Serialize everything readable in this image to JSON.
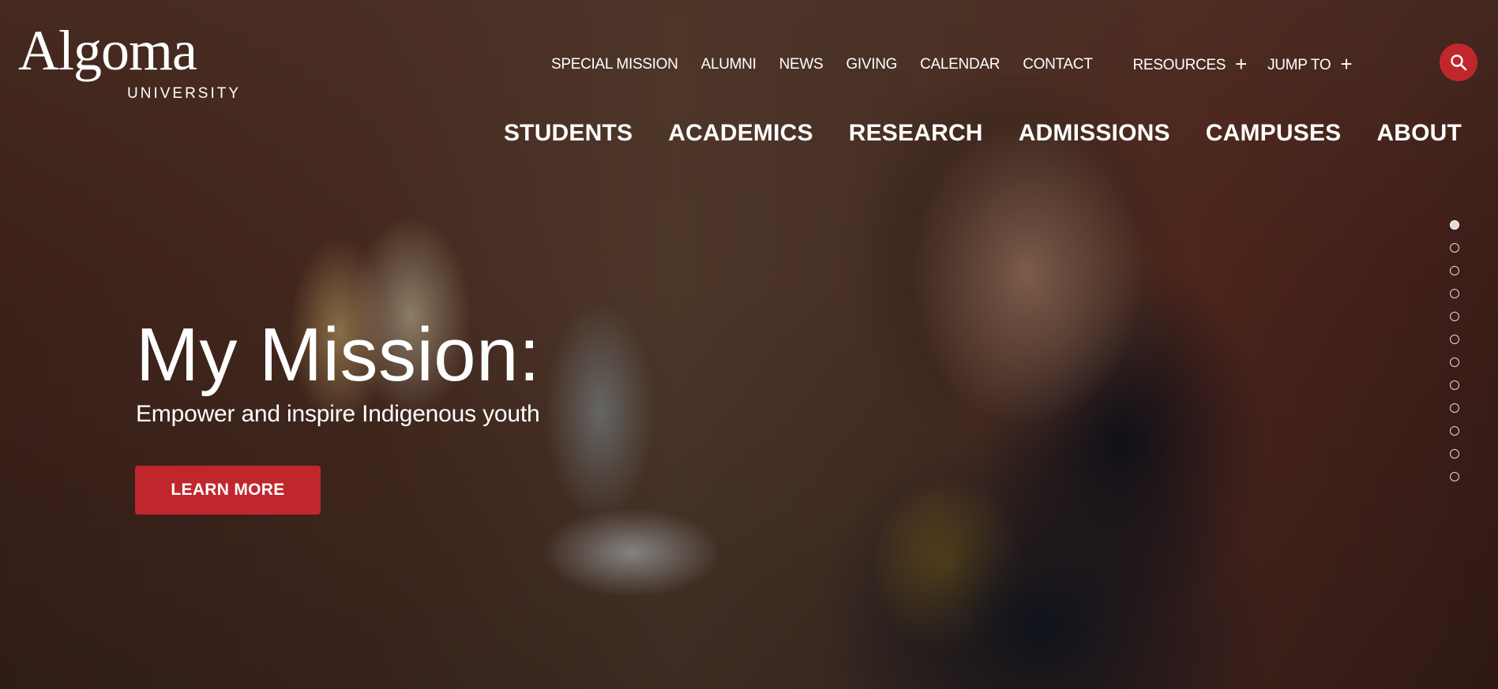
{
  "brand": {
    "logo_word": "Algoma",
    "logo_sub": "UNIVERSITY",
    "accent": "#c0272d"
  },
  "utility_nav": {
    "items": [
      "SPECIAL MISSION",
      "ALUMNI",
      "NEWS",
      "GIVING",
      "CALENDAR",
      "CONTACT"
    ],
    "resources": "RESOURCES",
    "jump_to": "JUMP TO",
    "plus": "+",
    "search_icon": "search-icon"
  },
  "main_nav": {
    "items": [
      "STUDENTS",
      "ACADEMICS",
      "RESEARCH",
      "ADMISSIONS",
      "CAMPUSES",
      "ABOUT"
    ]
  },
  "hero": {
    "title": "My Mission:",
    "subtitle": "Empower and inspire Indigenous youth",
    "cta_label": "LEARN MORE"
  },
  "slider": {
    "total_slides": 12,
    "active_index": 0
  }
}
